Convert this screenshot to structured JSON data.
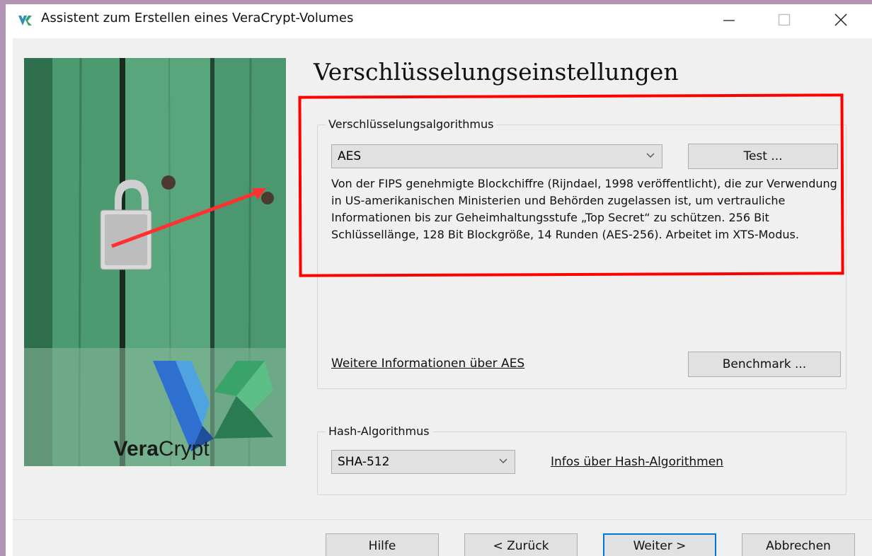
{
  "window": {
    "title": "Assistent zum Erstellen eines VeraCrypt-Volumes",
    "controls": {
      "minimize": "minimize-icon",
      "maximize": "maximize-icon",
      "close": "close-icon"
    }
  },
  "side_image": {
    "brand_part1": "Vera",
    "brand_part2": "Crypt"
  },
  "page": {
    "heading": "Verschlüsselungseinstellungen"
  },
  "encryption": {
    "group_label": "Verschlüsselungsalgorithmus",
    "selected": "AES",
    "test_button": "Test ...",
    "description": "Von der FIPS genehmigte Blockchiffre (Rijndael, 1998 veröffentlicht), die zur Verwendung in US-amerikanischen Ministerien und Behörden zugelassen ist, um vertrauliche Informationen bis zur Geheimhaltungsstufe „Top Secret“ zu schützen. 256 Bit Schlüssellänge, 128 Bit Blockgröße, 14 Runden (AES-256). Arbeitet im XTS-Modus.",
    "more_info_link": "Weitere Informationen über AES",
    "benchmark_button": "Benchmark ..."
  },
  "hash": {
    "group_label": "Hash-Algorithmus",
    "selected": "SHA-512",
    "info_link": "Infos über Hash-Algorithmen"
  },
  "footer": {
    "help": "Hilfe",
    "back": "< Zurück",
    "next": "Weiter >",
    "cancel": "Abbrechen"
  },
  "colors": {
    "highlight": "#ff0000",
    "dialog_bg": "#f0f0f0",
    "default_button_border": "#0078d7",
    "frame": "#b394b4"
  }
}
